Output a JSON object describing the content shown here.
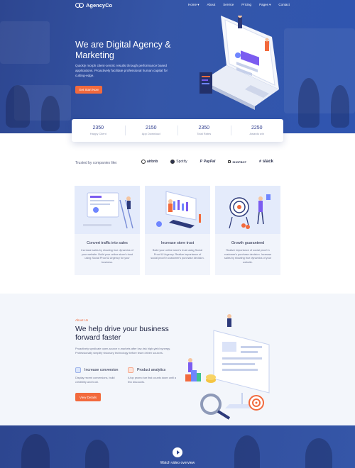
{
  "nav": {
    "logo_text": "AgencyCo",
    "items": [
      {
        "label": "Home ▾"
      },
      {
        "label": "About"
      },
      {
        "label": "Service"
      },
      {
        "label": "Pricing"
      },
      {
        "label": "Pages ▾"
      },
      {
        "label": "Contact"
      }
    ]
  },
  "hero": {
    "title": "We are Digital Agency & Marketing",
    "description": "Quickly morph client-centric results through performance based applications. Proactively facilitate professional human capital for cutting-edge.",
    "cta_label": "Get Start Now"
  },
  "stats": [
    {
      "value": "2350",
      "label": "Happy Client"
    },
    {
      "value": "2150",
      "label": "App Download"
    },
    {
      "value": "2350",
      "label": "Total Rates"
    },
    {
      "value": "2250",
      "label": "Awards win"
    }
  ],
  "trusted": {
    "label": "Trusted by companies like:",
    "brands": [
      {
        "name": "airbnb",
        "icon": "airbnb-icon"
      },
      {
        "name": "Spotify",
        "icon": "spotify-icon"
      },
      {
        "name": "PayPal",
        "icon": "paypal-icon"
      },
      {
        "name": "SHOPBOT",
        "icon": "shopbot-icon"
      },
      {
        "name": "slack",
        "icon": "slack-icon"
      }
    ]
  },
  "features": [
    {
      "title": "Convert traffic into sales",
      "text": "Increase sales by showing true dynamics of your website. Build your online store's trust using Social Proof & Urgency for your business."
    },
    {
      "title": "Increase store trust",
      "text": "Build your online store's trust using Social Proof & Urgency. Realize importance of social proof in customer's purchase decision."
    },
    {
      "title": "Growth guaranteed",
      "text": "Realize importance of social proof in customer's purchase decision. Increase sales by showing true dynamics of your website."
    }
  ],
  "about": {
    "eyebrow": "About Us",
    "title": "We help drive your business forward faster",
    "body": "Proactively syndicate open-source e-markets after low-risk high-yield synergy. Professionally simplify visionary technology before team driven sources.",
    "items": [
      {
        "title": "Increase conversion",
        "text": "Display recent conversions, build credibility and trust.",
        "color": "#dbe6fb"
      },
      {
        "title": "Product analytics",
        "text": "A top promo bar that counts down until a few discounts.",
        "color": "#fde3da"
      }
    ],
    "cta_label": "View Details"
  },
  "video": {
    "label": "Watch video overview"
  },
  "colors": {
    "brand_blue": "#3556a8",
    "accent_orange": "#f26a3d"
  }
}
